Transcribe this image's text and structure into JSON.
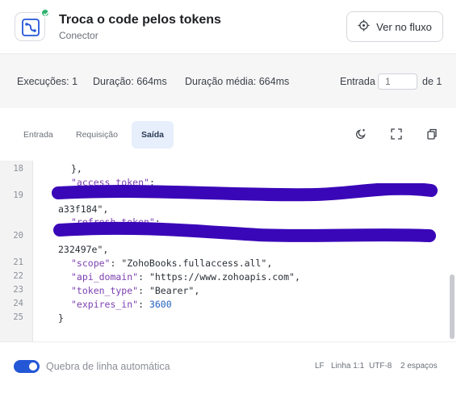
{
  "header": {
    "title": "Troca o code pelos tokens",
    "subtitle": "Conector",
    "flow_button_label": "Ver no fluxo",
    "app_icon": "connector-icon",
    "badge_icon": "check-icon"
  },
  "stats": {
    "executions": "Execuções: 1",
    "duration": "Duração: 664ms",
    "avg_duration": "Duração média: 664ms",
    "entry_label": "Entrada",
    "entry_placeholder": "1",
    "entry_of": "de 1"
  },
  "tabs": [
    {
      "label": "Entrada"
    },
    {
      "label": "Requisição"
    },
    {
      "label": "Saída"
    }
  ],
  "toolbar_icons": [
    "theme-moon-icon",
    "expand-icon",
    "copy-icon"
  ],
  "editor": {
    "lines": [
      {
        "n": "18",
        "text": "},"
      },
      {
        "n": "",
        "key": "\"access_token\"",
        "rest": ":"
      },
      {
        "n": "19",
        "text": ""
      },
      {
        "n": "",
        "text": "a33f184\","
      },
      {
        "n": "",
        "key": "\"refresh_token\"",
        "rest": ":"
      },
      {
        "n": "20",
        "text": ""
      },
      {
        "n": "",
        "text": "232497e\","
      },
      {
        "n": "21",
        "key": "\"scope\"",
        "rest": ": \"ZohoBooks.fullaccess.all\","
      },
      {
        "n": "22",
        "key": "\"api_domain\"",
        "rest": ": \"https://www.zohoapis.com\","
      },
      {
        "n": "23",
        "key": "\"token_type\"",
        "rest": ": \"Bearer\","
      },
      {
        "n": "24",
        "key": "\"expires_in\"",
        "rest": ": ",
        "num": "3600"
      },
      {
        "n": "25",
        "text": "}"
      }
    ],
    "redaction_color": "#3a07b8"
  },
  "footer": {
    "wrap_label": "Quebra de linha automática",
    "wrap_enabled": true,
    "line_ending": "LF",
    "position": "Linha 1:1",
    "encoding": "UTF-8",
    "indent": "2 espaços"
  },
  "colors": {
    "accent": "#2457d6",
    "success": "#2fb36f",
    "tab_active_bg": "#e7effc"
  }
}
